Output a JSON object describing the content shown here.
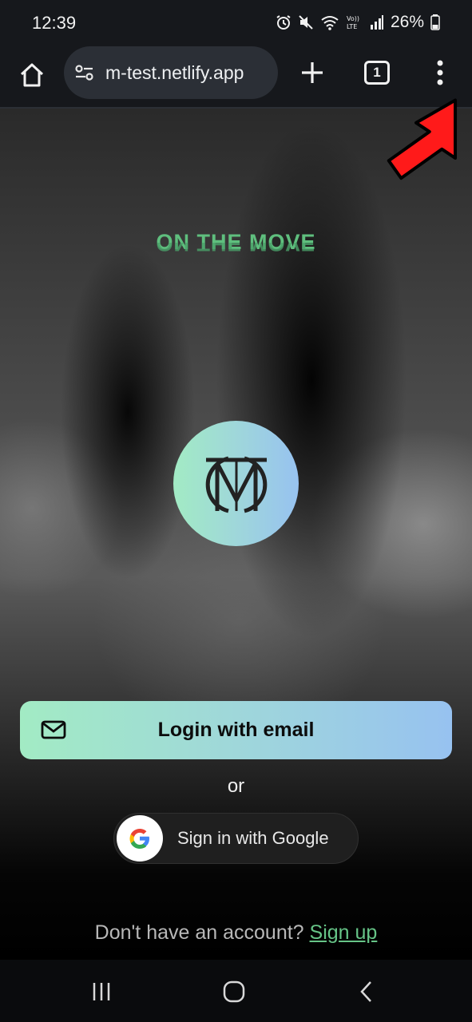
{
  "status_bar": {
    "time": "12:39",
    "battery": "26%",
    "icons": [
      "alarm-icon",
      "mute-icon",
      "wifi-icon",
      "volte-icon",
      "signal-icon",
      "battery-icon"
    ]
  },
  "browser": {
    "url": "m-test.netlify.app",
    "tab_count": "1",
    "icons": [
      "home-icon",
      "site-settings-icon",
      "new-tab-icon",
      "tab-switcher-icon",
      "more-menu-icon"
    ]
  },
  "page": {
    "brand_title": "ON THE MOVE",
    "logo": "OTM monogram",
    "email_button_label": "Login with email",
    "or_label": "or",
    "google_button_label": "Sign in with Google",
    "signup_prompt": "Don't have an account?",
    "signup_link": "Sign up"
  },
  "annotation": {
    "type": "red-arrow",
    "points_to": "more-menu-icon"
  },
  "colors": {
    "accent_green": "#5fbf7e",
    "gradient_start": "#a2ebc4",
    "gradient_end": "#97c2f0",
    "annotation_red": "#ff1a1a",
    "toolbar_bg": "#16181c"
  },
  "nav_bar": {
    "icons": [
      "recent-apps-icon",
      "home-circle-icon",
      "back-icon"
    ]
  }
}
